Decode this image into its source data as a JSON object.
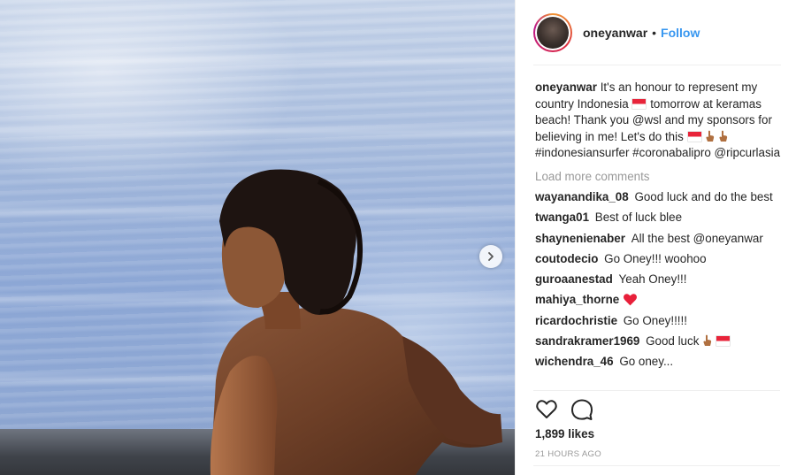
{
  "post": {
    "username": "oneyanwar",
    "separator": "•",
    "follow_label": "Follow",
    "caption": {
      "username": "oneyanwar",
      "text_1": "It's an honour to represent my country Indonesia",
      "text_2": "tomorrow at keramas beach! Thank you @wsl and my sponsors for believing in me! Let's do this",
      "text_3": "#indonesiansurfer #coronabalipro @ripcurlasia"
    },
    "load_more_label": "Load more comments",
    "comments": [
      {
        "username": "wayanandika_08",
        "text": "Good luck and do the best"
      },
      {
        "username": "twanga01",
        "text": "Best of luck blee"
      },
      {
        "username": "shaynenienaber",
        "text": "All the best @oneyanwar"
      },
      {
        "username": "coutodecio",
        "text": "Go Oney!!! woohoo"
      },
      {
        "username": "guroaanestad",
        "text": "Yeah Oney!!!"
      },
      {
        "username": "mahiya_thorne",
        "text": ""
      },
      {
        "username": "ricardochristie",
        "text": "Go Oney!!!!!"
      },
      {
        "username": "sandrakramer1969",
        "text": "Good luck"
      },
      {
        "username": "wichendra_46",
        "text": "Go oney..."
      }
    ],
    "likes_label": "1,899 likes",
    "timestamp": "21 HOURS AGO"
  },
  "icons": {
    "next": "chevron-right-icon",
    "like": "heart-outline-icon",
    "comment": "speech-bubble-icon",
    "flag": "indonesia-flag-emoji",
    "hand": "pointing-up-hand-emoji",
    "red_heart": "red-heart-emoji"
  },
  "colors": {
    "follow": "#3897f0",
    "text": "#262626",
    "muted": "#999999",
    "divider": "#efefef",
    "heart_emoji": "#e8203a"
  }
}
